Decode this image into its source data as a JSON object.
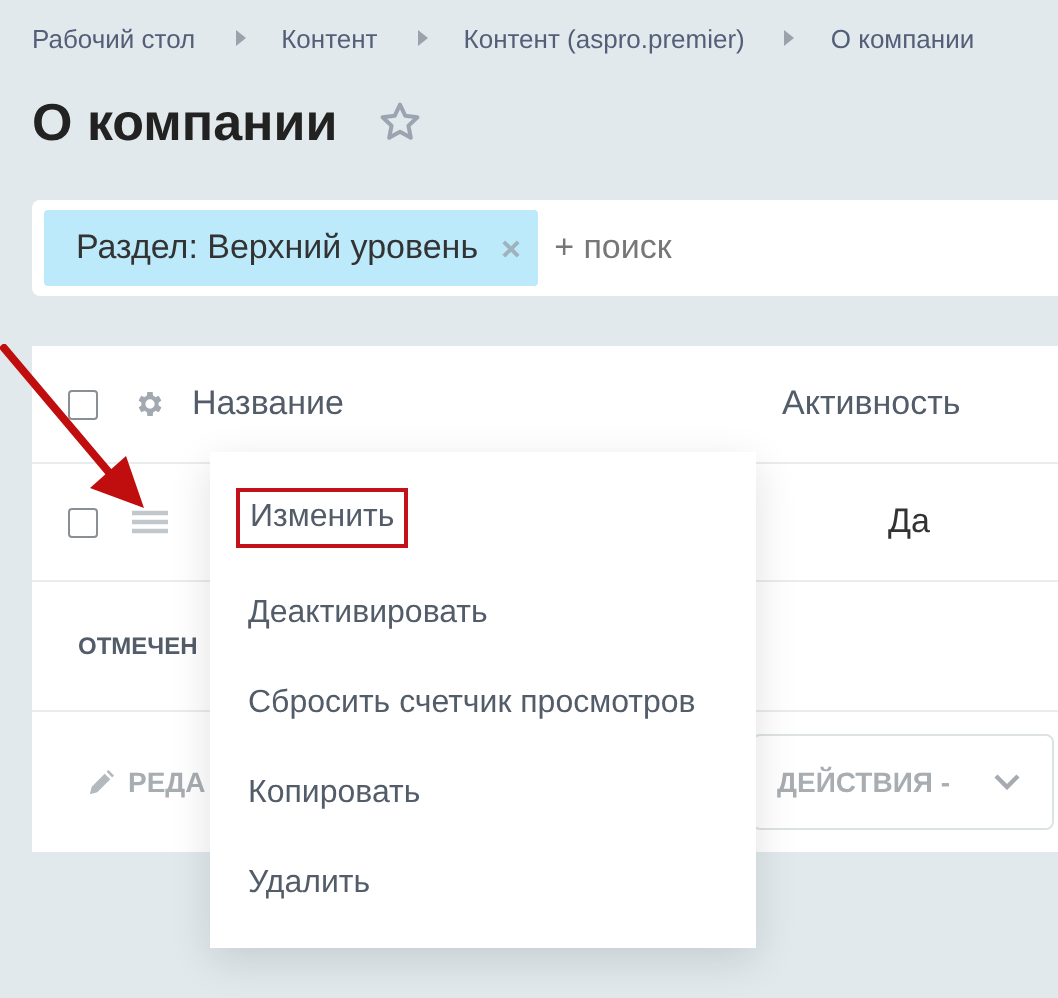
{
  "breadcrumbs": [
    "Рабочий стол",
    "Контент",
    "Контент (aspro.premier)",
    "О компании"
  ],
  "title": "О компании",
  "favorite": false,
  "filter": {
    "tag": "Раздел: Верхний уровень",
    "add_label": "+ поиск"
  },
  "table": {
    "all_checked": false,
    "columns": [
      "Название",
      "Активность"
    ],
    "rows": [
      {
        "checked": false,
        "active": "Да"
      }
    ],
    "footer_label": "ОТМЕЧЕН",
    "edit_label": "РЕДА",
    "actions_label": "ДЕЙСТВИЯ -"
  },
  "context_menu": [
    {
      "label": "Изменить",
      "highlighted": true
    },
    {
      "label": "Деактивировать",
      "highlighted": false
    },
    {
      "label": "Сбросить счетчик просмотров",
      "highlighted": false
    },
    {
      "label": "Копировать",
      "highlighted": false
    },
    {
      "label": "Удалить",
      "highlighted": false
    }
  ]
}
